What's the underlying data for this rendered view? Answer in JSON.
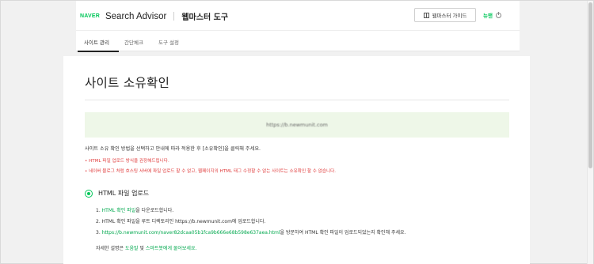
{
  "header": {
    "naver": "NAVER",
    "product": "Search Advisor",
    "tool_title": "웹마스터 도구",
    "guide_button": "웹마스터 가이드",
    "logout": "뉴맨"
  },
  "tabs": [
    {
      "label": "사이트 관리"
    },
    {
      "label": "간단체크"
    },
    {
      "label": "도구 설정"
    }
  ],
  "page": {
    "title": "사이트 소유확인",
    "site_url": "https://b.newmunit.com",
    "description": "사이트 소유 확인 방법을 선택하고 안내에 따라 적용한 후 [소유확인]을 클릭해 주세요.",
    "notes": [
      "• HTML 파일 업로드 방식을 권장해드립니다.",
      "• 네이버 블로그 처럼 호스팅 서버에 파일 업로드 할 수 없고, 웹페이지의 HTML 태그 수정할 수 없는 사이트는 소유확인 할 수 없습니다."
    ],
    "method": {
      "label": "HTML 파일 업로드",
      "step1_prefix": "1. ",
      "step1_link": "HTML 확인 파일",
      "step1_suffix": "을 다운로드합니다.",
      "step2": "2. HTML 확인 파일을 루트 디렉토리인 https://b.newmunit.com에 업로드합니다.",
      "step3_prefix": "3. ",
      "step3_link": "https://b.newmunit.com/naver82dcaa05b1fca9b666e68b598e637aea.html",
      "step3_suffix": "을 방문하여 HTML 확인 파일이 업로드되었는지 확인해 주세요.",
      "more_prefix": "자세한 설명은 ",
      "more_link1": "도움말",
      "more_mid": " 및 ",
      "more_link2": "스마트봇에게 물어보세요."
    }
  },
  "colors": {
    "accent": "#03c75a",
    "warning": "#e03c3c",
    "url_box_bg": "#eef7e8"
  }
}
